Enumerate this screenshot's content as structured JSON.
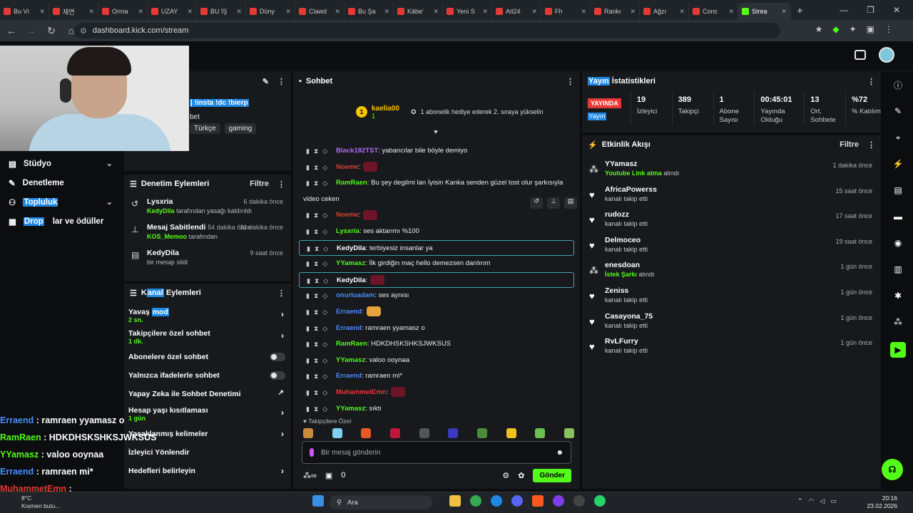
{
  "browser": {
    "tabs": [
      {
        "label": "Bu Vi"
      },
      {
        "label": "제연"
      },
      {
        "label": "Orma"
      },
      {
        "label": "UZAY"
      },
      {
        "label": "BU İŞ"
      },
      {
        "label": "Düny"
      },
      {
        "label": "Clawd"
      },
      {
        "label": "Bu Şa"
      },
      {
        "label": "Kâbe'"
      },
      {
        "label": "Yeni S"
      },
      {
        "label": "Ati24"
      },
      {
        "label": "Fh"
      },
      {
        "label": "Rankı"
      },
      {
        "label": "Ağzı"
      },
      {
        "label": "Conc"
      },
      {
        "label": "Strea",
        "active": true
      }
    ],
    "url": "dashboard.kick.com/stream"
  },
  "stream_info": {
    "title_text": "| !insta !dc !bierp",
    "title_suffix": "bet",
    "tags": [
      "Türkçe",
      "gaming"
    ]
  },
  "left_nav": {
    "items": [
      {
        "label": "Stüdyo",
        "icon": "studio-icon",
        "expandable": true
      },
      {
        "label": "Denetleme",
        "icon": "wrench-icon",
        "expandable": false
      },
      {
        "label": "Topluluk",
        "icon": "community-icon",
        "expandable": true
      },
      {
        "label": "Drop",
        "label_rest": "lar ve ödüller",
        "icon": "drops-icon",
        "expandable": false
      }
    ]
  },
  "moderation": {
    "title": "Denetim Eylemleri",
    "filter": "Filtre",
    "rows": [
      {
        "name": "Lysxria",
        "time": "6 dakika önce",
        "actor": "KedyDila",
        "text": " tarafından yasağı kaldırıldı",
        "icon": "undo-icon"
      },
      {
        "name": "Mesaj Sabitlendi",
        "extra": "54 dakika önce",
        "time": "31 dakika önce",
        "actor": "KOS_Memoo",
        "text": " tarafından",
        "icon": "pin-icon"
      },
      {
        "name": "KedyDila",
        "time": "9 saat önce",
        "actor": "",
        "text": "bir mesajı sildi",
        "icon": "trash-icon"
      }
    ]
  },
  "channel_actions": {
    "title_a": "K",
    "title_b": "anal",
    "title_c": " Eylemleri",
    "rows": [
      {
        "label_a": "Yavaş ",
        "label_b": "mod",
        "sub": "2 sn.",
        "type": "arrow"
      },
      {
        "label_a": "Takipçilere özel sohbet",
        "label_b": "",
        "sub": "1 dk.",
        "type": "arrow"
      },
      {
        "label_a": "Abonelere özel sohbet",
        "label_b": "",
        "sub": "",
        "type": "toggle"
      },
      {
        "label_a": "Yalnızca ifadelerle sohbet",
        "label_b": "",
        "sub": "",
        "type": "toggle"
      },
      {
        "label_a": "Yapay Zeka ile Sohbet Denetimi",
        "label_b": "",
        "sub": "",
        "type": "external"
      },
      {
        "label_a": "Hesap yaşı kısıtlaması",
        "label_b": "",
        "sub": "1 gün",
        "type": "arrow"
      },
      {
        "label_a": "Yasaklanmış kelimeler",
        "label_b": "",
        "sub": "",
        "type": "arrow"
      },
      {
        "label_a": "İzleyici Yönlendir",
        "label_b": "",
        "sub": "",
        "type": "none"
      },
      {
        "label_a": "Hedefleri belirleyin",
        "label_b": "",
        "sub": "",
        "type": "arrow"
      }
    ]
  },
  "overlay_chat": [
    {
      "user": "Erraend",
      "text": " : ramraen yyamasz o",
      "color": "#4a8cff"
    },
    {
      "user": "RamRaen",
      "text": " : HDKDHSKSHKSJWKSUS",
      "color": "#53fc18"
    },
    {
      "user": "YYamasz",
      "text": " : valoo ooynaa",
      "color": "#53fc18"
    },
    {
      "user": "Erraend",
      "text": " : ramraen mi*",
      "color": "#4a8cff"
    },
    {
      "user": "MuhammetEmn",
      "text": " :",
      "color": "#e53935"
    }
  ],
  "chat": {
    "title": "Sohbet",
    "pinned_user": "kaelia00",
    "pinned_count": "1",
    "pinned_text": "1 abonelik hediye ederek 2. sıraya yükselin",
    "messages": [
      {
        "user": "Black182TST",
        "color": "#b36bff",
        "text": ": yabancılar bile böyle demiyo",
        "blur": false,
        "boxed": false
      },
      {
        "user": "Noeme",
        "color": "#e53935",
        "text": ":",
        "blur": true,
        "boxed": false
      },
      {
        "user": "RamRaen",
        "color": "#53fc18",
        "text": ": Bu şey degilmi lan İyisin Kanka senden güzel tost olur şarkısıyla",
        "blur": false,
        "boxed": false
      },
      {
        "user": "",
        "color": "#eee",
        "text": "video ceken",
        "blur": false,
        "boxed": false,
        "cont": true
      },
      {
        "user": "Noeme",
        "color": "#e53935",
        "text": ":",
        "blur": true,
        "boxed": false
      },
      {
        "user": "Lysxria",
        "color": "#53fc18",
        "text": ": ses aktarımı %100",
        "blur": false,
        "boxed": false
      },
      {
        "user": "KedyDila",
        "color": "#ffffff",
        "text": ": terbiyesiz insanlar ya",
        "blur": false,
        "boxed": true
      },
      {
        "user": "YYamasz",
        "color": "#53fc18",
        "text": ": İlk girdiğin maç hello demezsen darılırım",
        "blur": false,
        "boxed": false
      },
      {
        "user": "KedyDila",
        "color": "#ffffff",
        "text": ":",
        "blur": true,
        "boxed": true
      },
      {
        "user": "onurluadam",
        "color": "#4a8cff",
        "text": ": ses aynısı",
        "blur": false,
        "boxed": false
      },
      {
        "user": "Erraend",
        "color": "#4a8cff",
        "text": ":",
        "blur": false,
        "boxed": false,
        "emote": true
      },
      {
        "user": "Erraend",
        "color": "#4a8cff",
        "text": ": ramraen yyamasz o",
        "blur": false,
        "boxed": false
      },
      {
        "user": "RamRaen",
        "color": "#53fc18",
        "text": ": HDKDHSKSHKSJWKSUS",
        "blur": false,
        "boxed": false
      },
      {
        "user": "YYamasz",
        "color": "#53fc18",
        "text": ": valoo ooynaa",
        "blur": false,
        "boxed": false
      },
      {
        "user": "Erraend",
        "color": "#4a8cff",
        "text": ": ramraen mi*",
        "blur": false,
        "boxed": false
      },
      {
        "user": "MuhammetEmn",
        "color": "#e53935",
        "text": ":",
        "blur": true,
        "boxed": false
      },
      {
        "user": "YYamasz",
        "color": "#53fc18",
        "text": ": sıktı",
        "blur": false,
        "boxed": false
      }
    ],
    "emote_label": "Takipçilere Özel",
    "input_placeholder": "Bir mesaj gönderin",
    "points": "0",
    "send": "Gönder"
  },
  "stats": {
    "title_a": "Yayın",
    "title_b": " İstatistikleri",
    "live": "YAYINDA",
    "live_sub": "Yayın",
    "items": [
      {
        "value": "19",
        "label": "İzleyici"
      },
      {
        "value": "389",
        "label": "Takipçi"
      },
      {
        "value": "1",
        "label": "Abone Sayısı"
      },
      {
        "value": "00:45:01",
        "label": "Yayında Olduğu"
      },
      {
        "value": "13",
        "label": "Ort. Sohbete"
      },
      {
        "value": "%72",
        "label": "% Katılım"
      }
    ]
  },
  "activity": {
    "title": "Etkinlik Akışı",
    "filter": "Filtre",
    "items": [
      {
        "name": "YYamasz",
        "hl": "Youtube Link atma",
        "rest": " alındı",
        "time": "1 dakika önce",
        "icon": "points-icon"
      },
      {
        "name": "AfricaPowerss",
        "hl": "",
        "rest": "kanalı takip etti",
        "time": "15 saat önce",
        "icon": "heart-icon"
      },
      {
        "name": "rudozz",
        "hl": "",
        "rest": "kanalı takip etti",
        "time": "17 saat önce",
        "icon": "heart-icon"
      },
      {
        "name": "Delmoceo",
        "hl": "",
        "rest": "kanalı takip etti",
        "time": "19 saat önce",
        "icon": "heart-icon"
      },
      {
        "name": "enesdoan",
        "hl": "İstek Şarkı",
        "rest": " alındı",
        "time": "1 gün önce",
        "icon": "points-icon"
      },
      {
        "name": "Zeniss",
        "hl": "",
        "rest": "kanalı takip etti",
        "time": "1 gün önce",
        "icon": "heart-icon"
      },
      {
        "name": "Casayona_75",
        "hl": "",
        "rest": "kanalı takip etti",
        "time": "1 gün önce",
        "icon": "heart-icon"
      },
      {
        "name": "RvLFurry",
        "hl": "",
        "rest": "kanalı takip etti",
        "time": "1 gün önce",
        "icon": "heart-icon"
      }
    ]
  },
  "taskbar": {
    "search": "Ara",
    "weather_temp": "8°C",
    "weather_desc": "Kısmen bulu...",
    "time": "20:16",
    "date": "23.02.2026"
  }
}
